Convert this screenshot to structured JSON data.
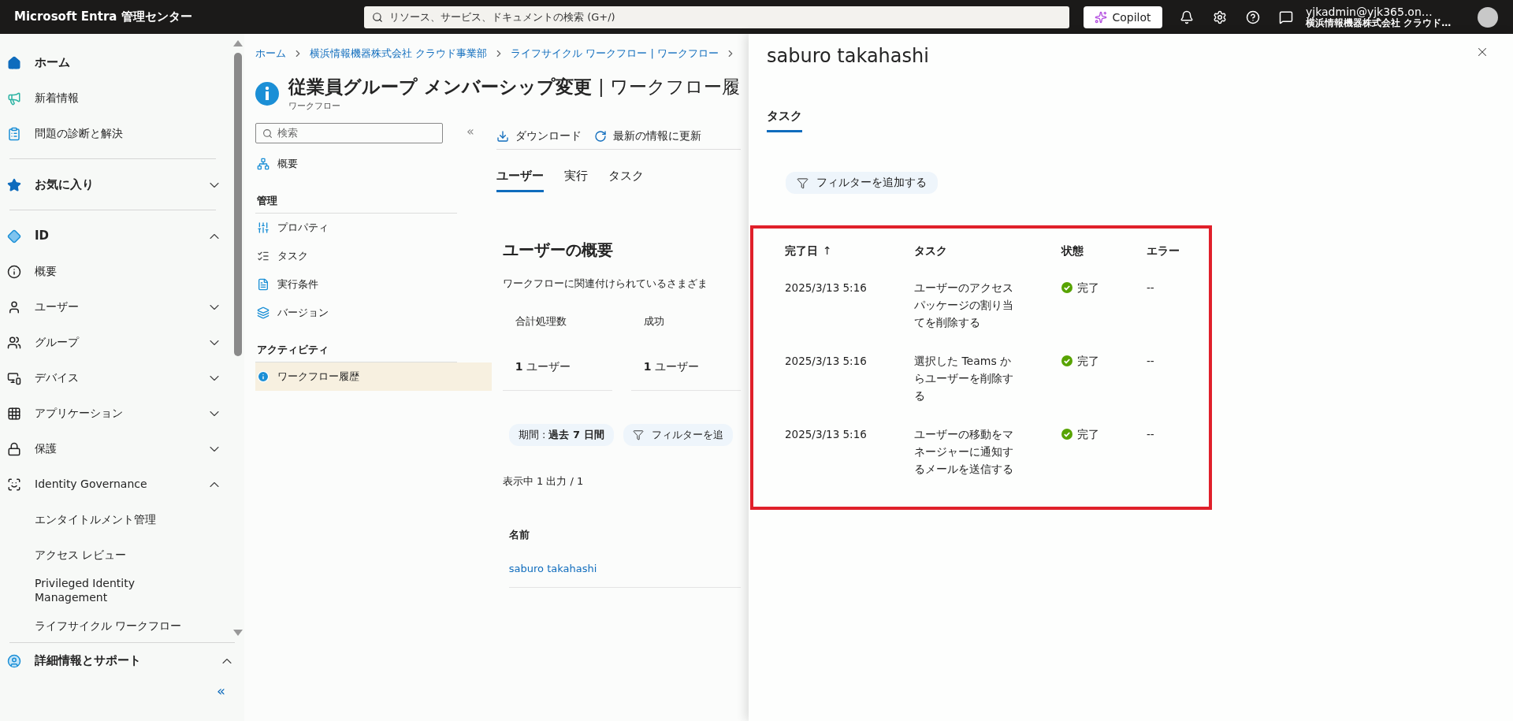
{
  "topbar": {
    "brand": "Microsoft Entra 管理センター",
    "search_placeholder": "リソース、サービス、ドキュメントの検索 (G+/)",
    "copilot": "Copilot",
    "user_email": "yjkadmin@yjk365.on…",
    "user_org": "横浜情報機器株式会社 クラウド…"
  },
  "sidebar": {
    "items": [
      {
        "kind": "item",
        "label": "ホーム",
        "bold": true
      },
      {
        "kind": "item",
        "label": "新着情報",
        "bold": false
      },
      {
        "kind": "item",
        "label": "問題の診断と解決",
        "bold": false
      },
      {
        "kind": "divider"
      },
      {
        "kind": "item",
        "label": "お気に入り",
        "bold": true,
        "expanded": false
      },
      {
        "kind": "divider"
      },
      {
        "kind": "item",
        "label": "ID",
        "bold": true,
        "expanded": true
      },
      {
        "kind": "item",
        "label": "概要",
        "bold": false
      },
      {
        "kind": "item",
        "label": "ユーザー",
        "bold": false,
        "expanded": false
      },
      {
        "kind": "item",
        "label": "グループ",
        "bold": false,
        "expanded": false
      },
      {
        "kind": "item",
        "label": "デバイス",
        "bold": false,
        "expanded": false
      },
      {
        "kind": "item",
        "label": "アプリケーション",
        "bold": false,
        "expanded": false
      },
      {
        "kind": "item",
        "label": "保護",
        "bold": false,
        "expanded": false
      },
      {
        "kind": "item",
        "label": "Identity Governance",
        "bold": false,
        "expanded": true
      },
      {
        "kind": "sub",
        "label": "エンタイトルメント管理"
      },
      {
        "kind": "sub",
        "label": "アクセス レビュー"
      },
      {
        "kind": "sub",
        "label": "Privileged Identity Management"
      },
      {
        "kind": "sub",
        "label": "ライフサイクル ワークフロー"
      }
    ],
    "footer": {
      "label": "詳細情報とサポート",
      "expanded": true
    },
    "collapse": "«"
  },
  "breadcrumb": [
    "ホーム",
    "横浜情報機器株式会社 クラウド事業部",
    "ライフサイクル ワークフロー | ワークフロー"
  ],
  "page": {
    "title": "従業員グループ メンバーシップ変更",
    "title_suffix": "| ワークフロー履",
    "subtitle": "ワークフロー"
  },
  "resource_menu": {
    "search_placeholder": "検索",
    "collapse": "«",
    "items": [
      {
        "kind": "item",
        "label": "概要",
        "selected": false
      },
      {
        "kind": "heading",
        "label": "管理"
      },
      {
        "kind": "item",
        "label": "プロパティ",
        "selected": false
      },
      {
        "kind": "item",
        "label": "タスク",
        "selected": false
      },
      {
        "kind": "item",
        "label": "実行条件",
        "selected": false
      },
      {
        "kind": "item",
        "label": "バージョン",
        "selected": false
      },
      {
        "kind": "heading",
        "label": "アクティビティ"
      },
      {
        "kind": "item",
        "label": "ワークフロー履歴",
        "selected": true
      }
    ]
  },
  "toolbar": [
    "ダウンロード",
    "最新の情報に更新"
  ],
  "tabs": [
    {
      "label": "ユーザー",
      "selected": true
    },
    {
      "label": "実行",
      "selected": false
    },
    {
      "label": "タスク",
      "selected": false
    }
  ],
  "summary": {
    "title": "ユーザーの概要",
    "description": "ワークフローに関連付けられているさまざま",
    "cards": [
      {
        "label": "合計処理数",
        "value": "1",
        "unit": "ユーザー"
      },
      {
        "label": "成功",
        "value": "1",
        "unit": "ユーザー"
      }
    ]
  },
  "filters": [
    {
      "kind": "period",
      "label": "期間 : **過去 7 日間**"
    },
    {
      "kind": "add",
      "label": "フィルターを追"
    }
  ],
  "results": "表示中 1 出力 / 1",
  "users_table": {
    "columns": [
      "名前"
    ],
    "rows": [
      [
        "saburo takahashi"
      ]
    ]
  },
  "panel": {
    "title": "saburo takahashi",
    "tabs": [
      {
        "label": "タスク",
        "selected": true
      }
    ],
    "filter": "フィルターを追加する",
    "highlight": true,
    "table": {
      "columns": [
        {
          "label": "完了日",
          "sort": "↑"
        },
        {
          "label": "タスク"
        },
        {
          "label": "状態"
        },
        {
          "label": "エラー"
        }
      ],
      "rows": [
        {
          "date": "2025/3/13 5:16",
          "task": "ユーザーのアクセスパッケージの割り当てを削除する",
          "status": "完了",
          "error": "--"
        },
        {
          "date": "2025/3/13 5:16",
          "task": "選択した Teams からユーザーを削除する",
          "status": "完了",
          "error": "--"
        },
        {
          "date": "2025/3/13 5:16",
          "task": "ユーザーの移動をマネージャーに通知するメールを送信する",
          "status": "完了",
          "error": "--"
        }
      ]
    }
  }
}
